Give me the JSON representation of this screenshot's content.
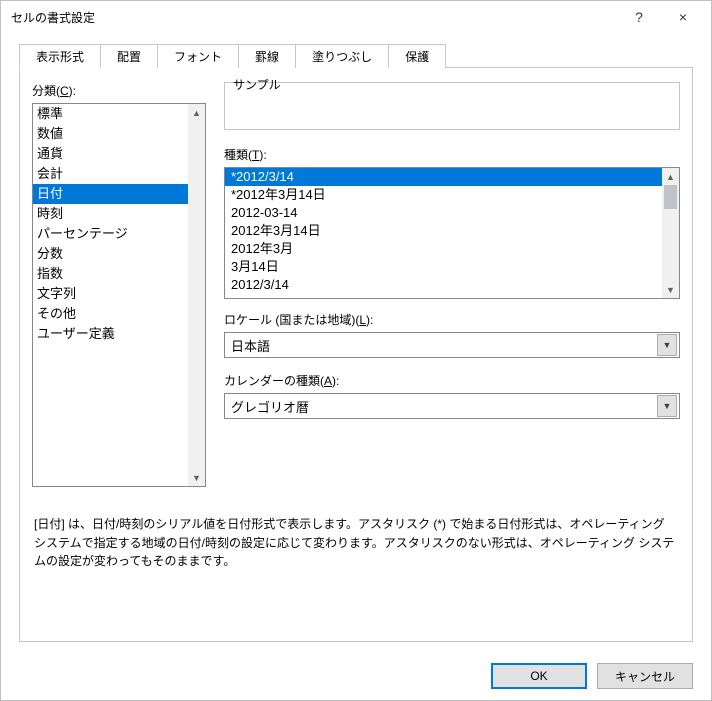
{
  "window": {
    "title": "セルの書式設定",
    "help_tooltip": "?",
    "close_tooltip": "×"
  },
  "tabs": {
    "display": "表示形式",
    "align": "配置",
    "font": "フォント",
    "border": "罫線",
    "fill": "塗りつぶし",
    "protect": "保護"
  },
  "category": {
    "label_prefix": "分類(",
    "label_key": "C",
    "label_suffix": "):",
    "items": [
      "標準",
      "数値",
      "通貨",
      "会計",
      "日付",
      "時刻",
      "パーセンテージ",
      "分数",
      "指数",
      "文字列",
      "その他",
      "ユーザー定義"
    ],
    "selected": "日付"
  },
  "sample": {
    "label": "サンプル",
    "value": ""
  },
  "type": {
    "label_prefix": "種類(",
    "label_key": "T",
    "label_suffix": "):",
    "items": [
      "*2012/3/14",
      "*2012年3月14日",
      "2012-03-14",
      "2012年3月14日",
      "2012年3月",
      "3月14日",
      "2012/3/14"
    ],
    "selected": "*2012/3/14"
  },
  "locale": {
    "label_prefix": "ロケール (国または地域)(",
    "label_key": "L",
    "label_suffix": "):",
    "value": "日本語"
  },
  "calendar": {
    "label_prefix": "カレンダーの種類(",
    "label_key": "A",
    "label_suffix": "):",
    "value": "グレゴリオ暦"
  },
  "description": "[日付] は、日付/時刻のシリアル値を日付形式で表示します。アスタリスク (*) で始まる日付形式は、オペレーティング システムで指定する地域の日付/時刻の設定に応じて変わります。アスタリスクのない形式は、オペレーティング システムの設定が変わってもそのままです。",
  "buttons": {
    "ok": "OK",
    "cancel": "キャンセル"
  }
}
